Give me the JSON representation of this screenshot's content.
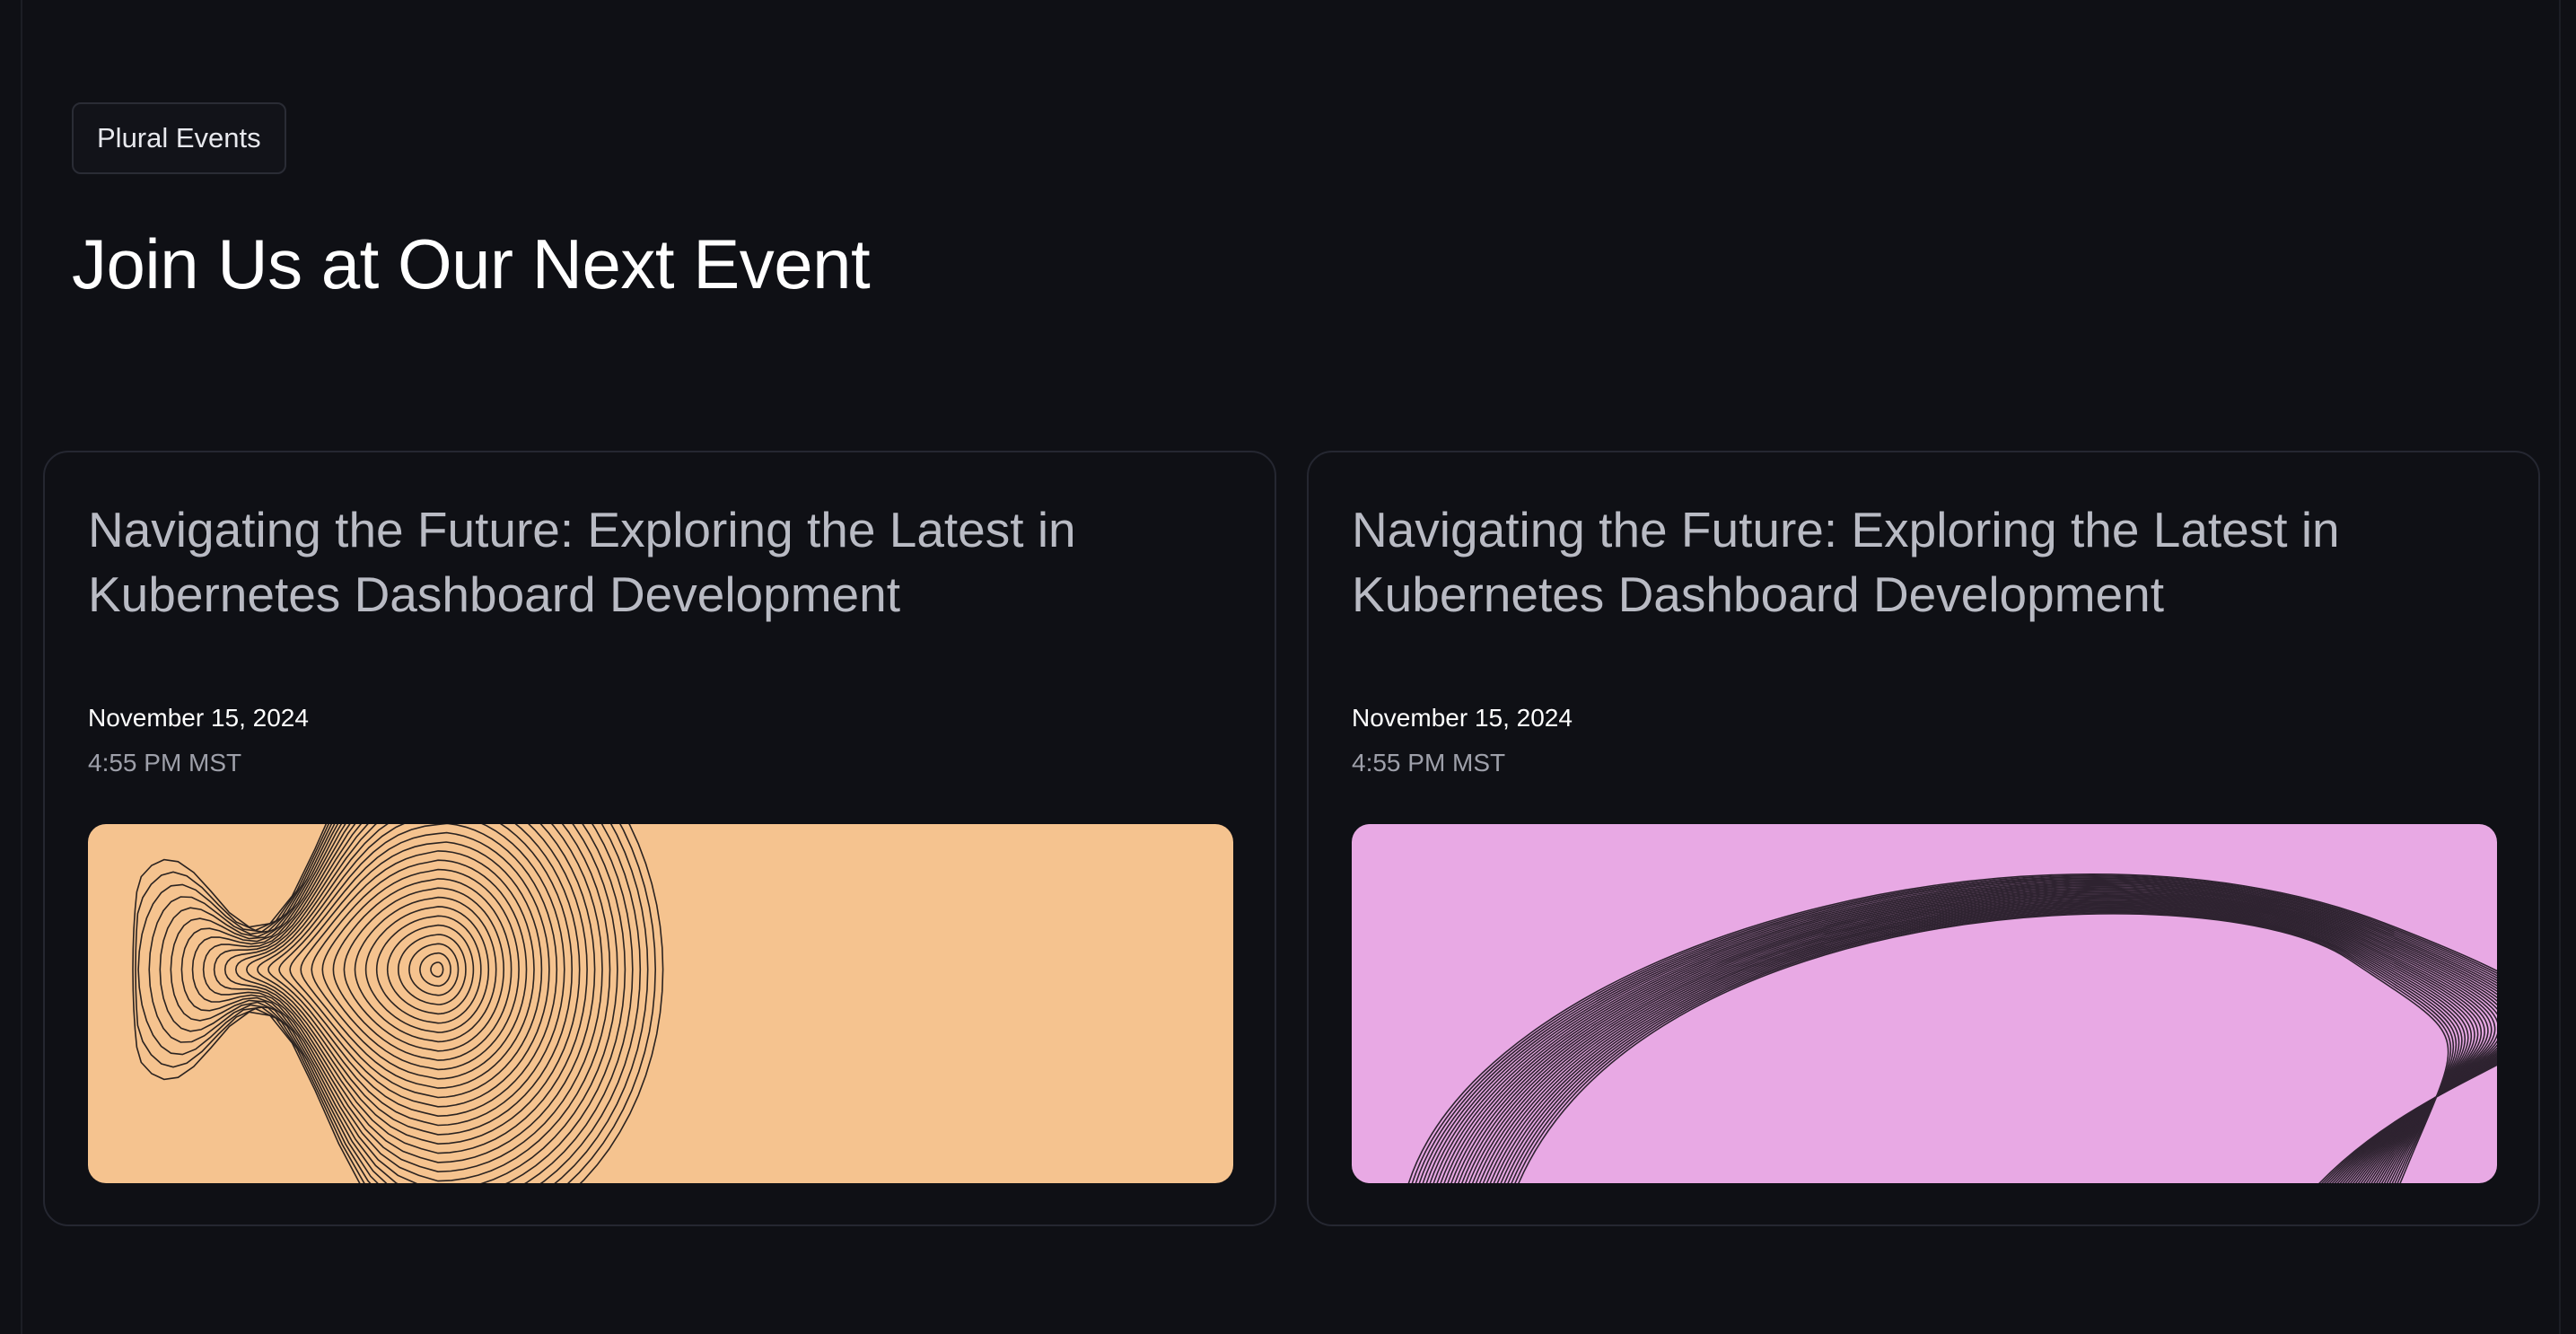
{
  "tag": {
    "label": "Plural Events"
  },
  "heading": {
    "title": "Join Us at Our Next Event"
  },
  "events": [
    {
      "title": "Navigating the Future: Exploring the Latest in Kubernetes Dashboard Development",
      "date": "November 15, 2024",
      "time": "4:55 PM MST",
      "image_color": "#f5c38f",
      "image_pattern": "contour-lines-art"
    },
    {
      "title": "Navigating the Future: Exploring the Latest in Kubernetes Dashboard Development",
      "date": "November 15, 2024",
      "time": "4:55 PM MST",
      "image_color": "#e8a9e4",
      "image_pattern": "arc-lines-art"
    }
  ],
  "colors": {
    "background": "#0f1015",
    "card_border": "#252731",
    "title_text": "#b9bbc4",
    "time_text": "#9ea0aa"
  }
}
